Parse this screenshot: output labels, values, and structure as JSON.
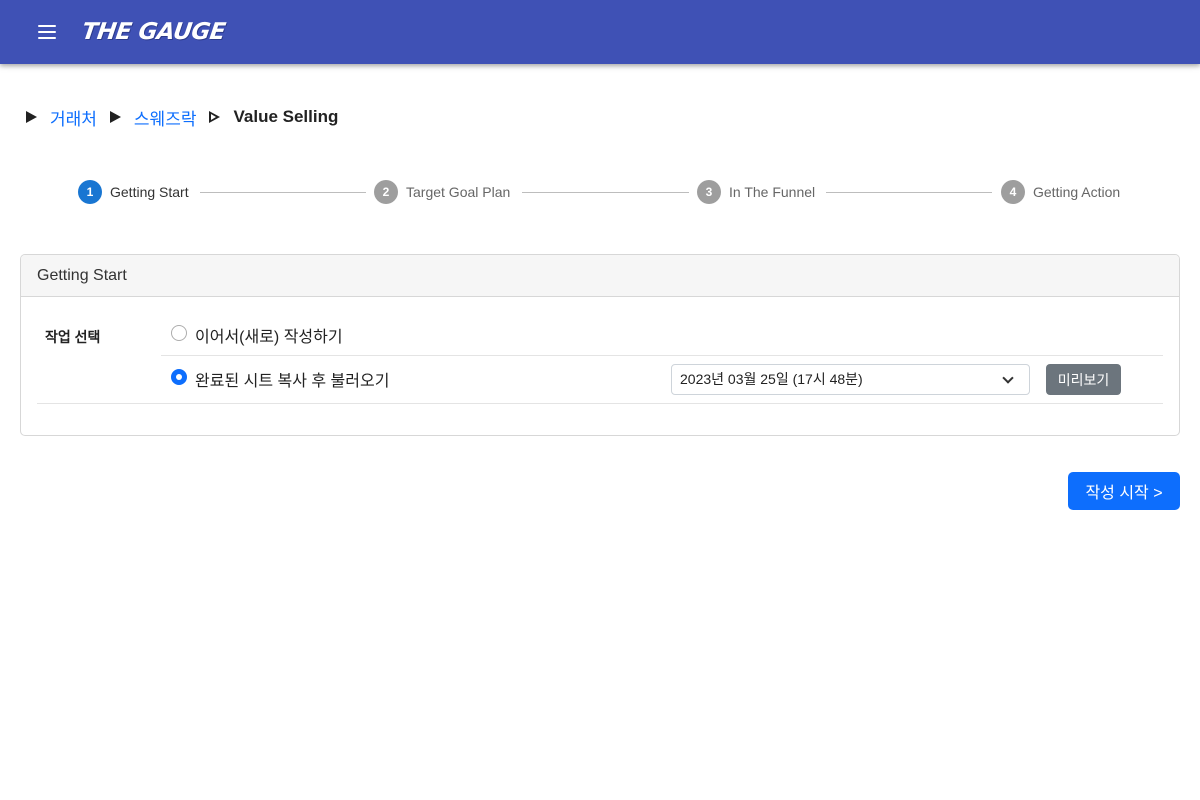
{
  "app": {
    "logo_text": "THE GAUGE",
    "colors": {
      "appbar": "#3f51b5",
      "primary": "#0d6efd",
      "step_active": "#1976d2",
      "step_inactive": "#9e9e9e",
      "secondary": "#6c757d"
    }
  },
  "header": {
    "menu_icon": "hamburger-menu-icon"
  },
  "breadcrumb": {
    "items": [
      {
        "label": "거래처",
        "link": true
      },
      {
        "label": "스웨즈락",
        "link": true
      },
      {
        "label": "Value Selling",
        "link": false
      }
    ]
  },
  "stepper": {
    "steps": [
      {
        "number": "1",
        "label": "Getting Start",
        "active": true
      },
      {
        "number": "2",
        "label": "Target Goal Plan",
        "active": false
      },
      {
        "number": "3",
        "label": "In The Funnel",
        "active": false
      },
      {
        "number": "4",
        "label": "Getting Action",
        "active": false
      }
    ]
  },
  "card": {
    "title": "Getting Start",
    "field_label": "작업 선택",
    "options": [
      {
        "label": "이어서(새로) 작성하기",
        "selected": false
      },
      {
        "label": "완료된 시트 복사 후 불러오기",
        "selected": true
      }
    ],
    "sheet_select": {
      "value": "2023년 03월 25일 (17시 48분)"
    },
    "preview_label": "미리보기"
  },
  "actions": {
    "start_label": "작성 시작 >"
  }
}
